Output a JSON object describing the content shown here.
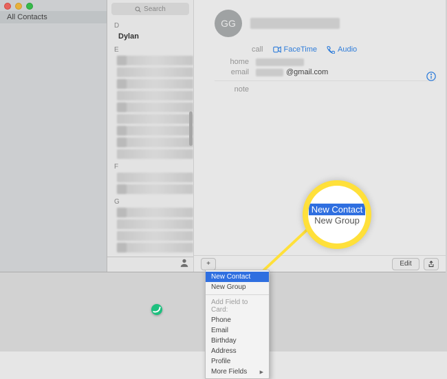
{
  "sidebar": {
    "all_contacts": "All Contacts"
  },
  "search": {
    "placeholder": "Search"
  },
  "sections": {
    "D": {
      "letter": "D",
      "names": [
        "Dylan"
      ]
    },
    "E": {
      "letter": "E"
    },
    "F": {
      "letter": "F"
    },
    "G": {
      "letter": "G"
    }
  },
  "detail": {
    "initials": "GG",
    "call_label": "call",
    "facetime": "FaceTime",
    "audio": "Audio",
    "home_label": "home",
    "email_label": "email",
    "email_domain": "@gmail.com",
    "note_label": "note"
  },
  "footer": {
    "plus": "+",
    "edit": "Edit"
  },
  "menu": {
    "new_contact": "New Contact",
    "new_group": "New Group",
    "header": "Add Field to Card:",
    "phone": "Phone",
    "email": "Email",
    "birthday": "Birthday",
    "address": "Address",
    "profile": "Profile",
    "more_fields": "More Fields"
  },
  "callout": {
    "line1": "New Contact",
    "line2": "New Group"
  }
}
